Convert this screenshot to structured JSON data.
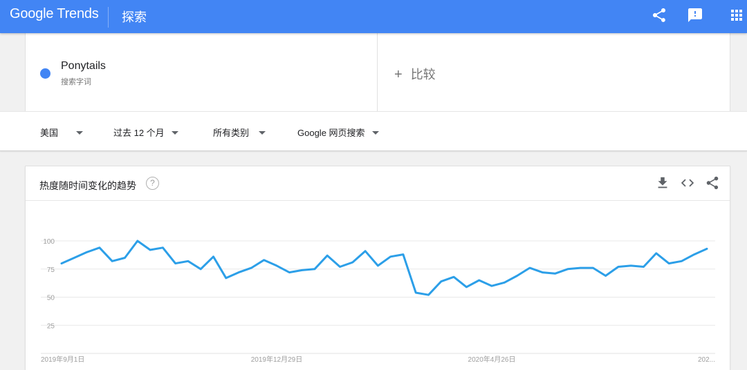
{
  "header": {
    "logo_google": "Google",
    "logo_trends": "Trends",
    "page_title": "探索",
    "icons": [
      "share-icon",
      "feedback-icon",
      "apps-icon"
    ]
  },
  "term": {
    "name": "Ponytails",
    "subtitle": "搜索字词",
    "color": "#4285f4",
    "compare_plus": "+",
    "compare_label": "比较"
  },
  "filters": {
    "region": "美国",
    "time_range": "过去 12 个月",
    "category": "所有类别",
    "search_type": "Google 网页搜索"
  },
  "card": {
    "title": "热度随时间变化的趋势",
    "help": "?",
    "icons": [
      "download-icon",
      "embed-icon",
      "share-icon"
    ]
  },
  "chart_data": {
    "type": "line",
    "title": "",
    "xlabel": "",
    "ylabel": "",
    "ylim": [
      0,
      100
    ],
    "yticks": [
      25,
      50,
      75,
      100
    ],
    "grid": true,
    "x_tick_labels": [
      "2019年9月1日",
      "2019年12月29日",
      "2020年4月26日",
      "202..."
    ],
    "x_tick_index": [
      0,
      17,
      34,
      52
    ],
    "series": [
      {
        "color": "#2c9fe8",
        "values": [
          80,
          85,
          90,
          94,
          82,
          85,
          100,
          92,
          94,
          80,
          82,
          75,
          86,
          67,
          72,
          76,
          83,
          78,
          72,
          74,
          75,
          87,
          77,
          81,
          91,
          78,
          86,
          88,
          54,
          52,
          64,
          68,
          59,
          65,
          60,
          63,
          69,
          76,
          72,
          71,
          75,
          76,
          76,
          69,
          77,
          78,
          77,
          89,
          80,
          82,
          88,
          93
        ]
      }
    ]
  }
}
